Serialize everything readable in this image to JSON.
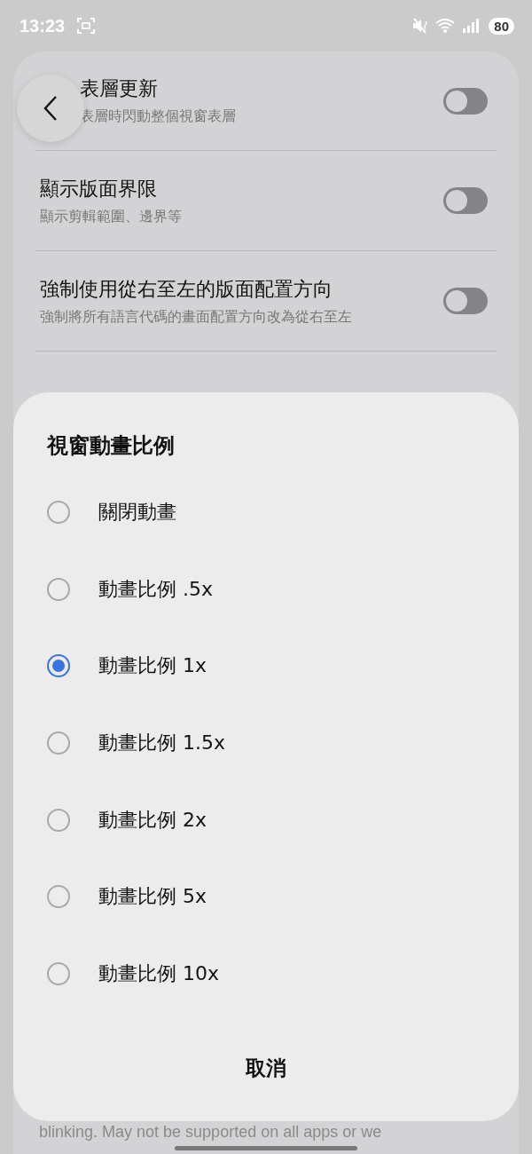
{
  "status_bar": {
    "time": "13:23",
    "battery": "80"
  },
  "settings": [
    {
      "title": "表層更新",
      "subtitle": "表層時閃動整個視窗表層",
      "on": false,
      "kind": "clipped"
    },
    {
      "title": "顯示版面界限",
      "subtitle": "顯示剪輯範圍、邊界等",
      "on": false,
      "kind": "toggle"
    },
    {
      "title": "強制使用從右至左的版面配置方向",
      "subtitle": "強制將所有語言代碼的畫面配置方向改為從右至左",
      "on": false,
      "kind": "toggle"
    }
  ],
  "footer_text": "blinking. May not be supported on all apps or we",
  "dialog": {
    "title": "視窗動畫比例",
    "options": [
      {
        "label": "關閉動畫",
        "selected": false
      },
      {
        "label": "動畫比例 .5x",
        "selected": false
      },
      {
        "label": "動畫比例 1x",
        "selected": true
      },
      {
        "label": "動畫比例 1.5x",
        "selected": false
      },
      {
        "label": "動畫比例 2x",
        "selected": false
      },
      {
        "label": "動畫比例 5x",
        "selected": false
      },
      {
        "label": "動畫比例 10x",
        "selected": false
      }
    ],
    "cancel": "取消"
  }
}
